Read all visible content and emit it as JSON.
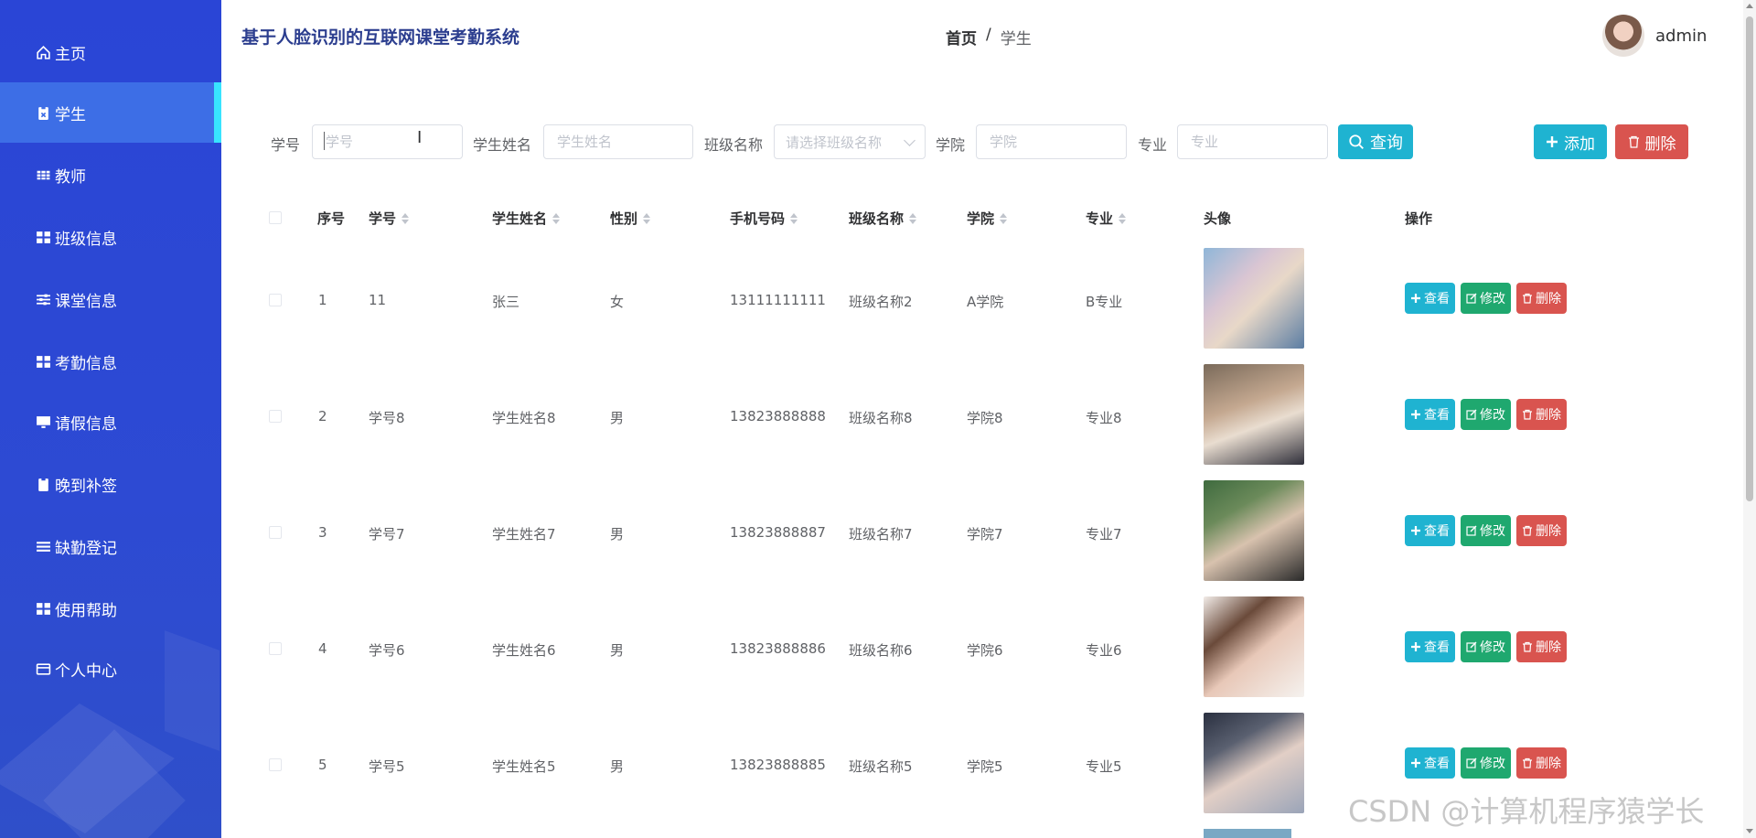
{
  "sidebar": {
    "items": [
      {
        "label": "主页",
        "icon": "home-icon"
      },
      {
        "label": "学生",
        "icon": "clipboard-icon",
        "active": true
      },
      {
        "label": "教师",
        "icon": "grid-icon"
      },
      {
        "label": "班级信息",
        "icon": "apps-icon"
      },
      {
        "label": "课堂信息",
        "icon": "sliders-icon"
      },
      {
        "label": "考勤信息",
        "icon": "apps-icon"
      },
      {
        "label": "请假信息",
        "icon": "monitor-icon"
      },
      {
        "label": "晚到补签",
        "icon": "clipboard-icon"
      },
      {
        "label": "缺勤登记",
        "icon": "list-icon"
      },
      {
        "label": "使用帮助",
        "icon": "apps-icon"
      },
      {
        "label": "个人中心",
        "icon": "card-icon"
      }
    ]
  },
  "header": {
    "title": "基于人脸识别的互联网课堂考勤系统",
    "breadcrumb": {
      "home": "首页",
      "separator": "/",
      "current": "学生"
    },
    "user": {
      "name": "admin"
    }
  },
  "search": {
    "fields": [
      {
        "label": "学号",
        "placeholder": "学号"
      },
      {
        "label": "学生姓名",
        "placeholder": "学生姓名"
      },
      {
        "label": "班级名称",
        "placeholder": "请选择班级名称"
      },
      {
        "label": "学院",
        "placeholder": "学院"
      },
      {
        "label": "专业",
        "placeholder": "专业"
      }
    ],
    "query_label": "查询",
    "add_label": "添加",
    "delete_label": "删除"
  },
  "table": {
    "columns": [
      "序号",
      "学号",
      "学生姓名",
      "性别",
      "手机号码",
      "班级名称",
      "学院",
      "专业",
      "头像",
      "操作"
    ],
    "rows": [
      {
        "no": "1",
        "id": "11",
        "name": "张三",
        "gender": "女",
        "phone": "13111111111",
        "class": "班级名称2",
        "college": "A学院",
        "major": "B专业"
      },
      {
        "no": "2",
        "id": "学号8",
        "name": "学生姓名8",
        "gender": "男",
        "phone": "13823888888",
        "class": "班级名称8",
        "college": "学院8",
        "major": "专业8"
      },
      {
        "no": "3",
        "id": "学号7",
        "name": "学生姓名7",
        "gender": "男",
        "phone": "13823888887",
        "class": "班级名称7",
        "college": "学院7",
        "major": "专业7"
      },
      {
        "no": "4",
        "id": "学号6",
        "name": "学生姓名6",
        "gender": "男",
        "phone": "13823888886",
        "class": "班级名称6",
        "college": "学院6",
        "major": "专业6"
      },
      {
        "no": "5",
        "id": "学号5",
        "name": "学生姓名5",
        "gender": "男",
        "phone": "13823888885",
        "class": "班级名称5",
        "college": "学院5",
        "major": "专业5"
      }
    ],
    "actions": {
      "view": "查看",
      "edit": "修改",
      "delete": "删除"
    }
  },
  "colors": {
    "sidebar": "#2a45d6",
    "active": "#3d6ee6",
    "info": "#1fb3d1",
    "success": "#1fa86f",
    "danger": "#d9544f"
  },
  "watermark": "CSDN @计算机程序猿学长"
}
